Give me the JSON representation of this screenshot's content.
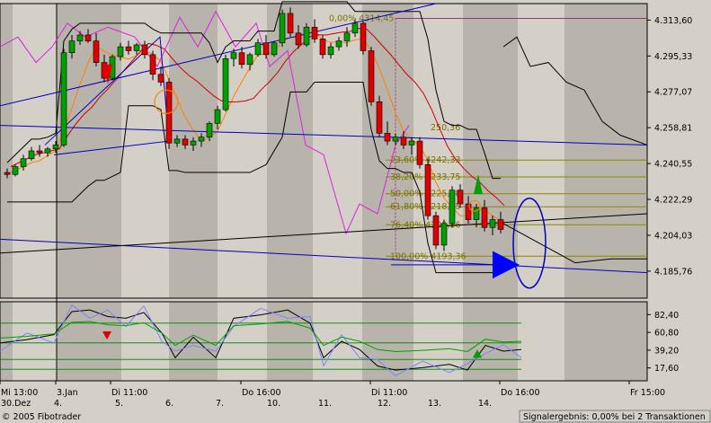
{
  "chart_data": {
    "type": "candlestick",
    "price_axis": {
      "ticks": [
        "4.313,60",
        "4.295,33",
        "4.277,07",
        "4.258,81",
        "4.240,55",
        "4.222,29",
        "4.204,03",
        "4.185,76"
      ],
      "values": [
        4313.6,
        4295.33,
        4277.07,
        4258.81,
        4240.55,
        4222.29,
        4204.03,
        4185.76
      ]
    },
    "oscillator_axis": {
      "ticks": [
        "82,40",
        "60,80",
        "39,20",
        "17,60"
      ],
      "values": [
        82.4,
        60.8,
        39.2,
        17.6
      ]
    },
    "time_axis": {
      "top": [
        "Mi 13:00",
        "3.Jan",
        "Di 11:00",
        "Do 16:00",
        "Di 11:00",
        "Do 16:00",
        "Fr 15:00"
      ],
      "bottom": [
        "30.Dez",
        "4.",
        "5.",
        "6.",
        "7.",
        "10.",
        "11.",
        "12.",
        "13.",
        "14."
      ]
    },
    "fibonacci": [
      {
        "label": "0,00% 4314,45",
        "value": 4314.45
      },
      {
        "label": "23,60% 4242,33",
        "value": 4242.33
      },
      {
        "label": "38,20% 4233,75",
        "value": 4233.75
      },
      {
        "label": "50,00% 4225,18",
        "value": 4225.18
      },
      {
        "label": "61,80% 4218,55",
        "value": 4218.55
      },
      {
        "label": "76,40% 4209,36",
        "value": 4209.36
      },
      {
        "label": "100,00% 4193,36",
        "value": 4193.36
      }
    ],
    "fib_partial_label": "250,36",
    "candles": [
      [
        4236,
        4238,
        4233,
        4235
      ],
      [
        4235,
        4240,
        4234,
        4239
      ],
      [
        4239,
        4245,
        4237,
        4243
      ],
      [
        4243,
        4249,
        4242,
        4247
      ],
      [
        4247,
        4250,
        4244,
        4246
      ],
      [
        4246,
        4249,
        4244,
        4248
      ],
      [
        4248,
        4252,
        4246,
        4250
      ],
      [
        4250,
        4299,
        4249,
        4297
      ],
      [
        4297,
        4306,
        4294,
        4303
      ],
      [
        4303,
        4308,
        4301,
        4306
      ],
      [
        4306,
        4309,
        4302,
        4303
      ],
      [
        4303,
        4307,
        4290,
        4292
      ],
      [
        4292,
        4296,
        4282,
        4284
      ],
      [
        4284,
        4296,
        4283,
        4295
      ],
      [
        4295,
        4302,
        4293,
        4300
      ],
      [
        4300,
        4303,
        4296,
        4298
      ],
      [
        4298,
        4302,
        4296,
        4301
      ],
      [
        4301,
        4303,
        4294,
        4296
      ],
      [
        4296,
        4298,
        4283,
        4286
      ],
      [
        4286,
        4290,
        4280,
        4282
      ],
      [
        4282,
        4284,
        4248,
        4251
      ],
      [
        4251,
        4255,
        4249,
        4253
      ],
      [
        4253,
        4255,
        4248,
        4250
      ],
      [
        4250,
        4254,
        4247,
        4252
      ],
      [
        4252,
        4256,
        4249,
        4254
      ],
      [
        4254,
        4262,
        4252,
        4261
      ],
      [
        4261,
        4270,
        4258,
        4268
      ],
      [
        4268,
        4296,
        4267,
        4294
      ],
      [
        4294,
        4299,
        4290,
        4297
      ],
      [
        4297,
        4300,
        4289,
        4291
      ],
      [
        4291,
        4297,
        4288,
        4296
      ],
      [
        4296,
        4304,
        4295,
        4302
      ],
      [
        4302,
        4306,
        4294,
        4296
      ],
      [
        4296,
        4303,
        4295,
        4302
      ],
      [
        4302,
        4319,
        4300,
        4317
      ],
      [
        4317,
        4320,
        4305,
        4307
      ],
      [
        4307,
        4311,
        4299,
        4301
      ],
      [
        4301,
        4312,
        4300,
        4310
      ],
      [
        4310,
        4314,
        4302,
        4304
      ],
      [
        4304,
        4306,
        4294,
        4296
      ],
      [
        4296,
        4302,
        4294,
        4300
      ],
      [
        4300,
        4305,
        4298,
        4303
      ],
      [
        4303,
        4310,
        4300,
        4307
      ],
      [
        4307,
        4314,
        4305,
        4312
      ],
      [
        4312,
        4313,
        4296,
        4298
      ],
      [
        4298,
        4300,
        4270,
        4272
      ],
      [
        4272,
        4275,
        4254,
        4256
      ],
      [
        4256,
        4262,
        4250,
        4252
      ],
      [
        4252,
        4256,
        4250,
        4254
      ],
      [
        4254,
        4257,
        4248,
        4250
      ],
      [
        4250,
        4254,
        4245,
        4252
      ],
      [
        4252,
        4254,
        4238,
        4240
      ],
      [
        4240,
        4243,
        4212,
        4214
      ],
      [
        4214,
        4216,
        4197,
        4199
      ],
      [
        4199,
        4212,
        4196,
        4210
      ],
      [
        4210,
        4229,
        4208,
        4227
      ],
      [
        4227,
        4230,
        4218,
        4220
      ],
      [
        4220,
        4224,
        4210,
        4212
      ],
      [
        4212,
        4220,
        4208,
        4218
      ],
      [
        4218,
        4222,
        4206,
        4208
      ],
      [
        4208,
        4214,
        4204,
        4212
      ],
      [
        4212,
        4216,
        4205,
        4207
      ]
    ],
    "footer_left": "© 2005 Fibotrader",
    "footer_right": "Signalergebnis: 0,00% bei 2 Transaktionen"
  }
}
